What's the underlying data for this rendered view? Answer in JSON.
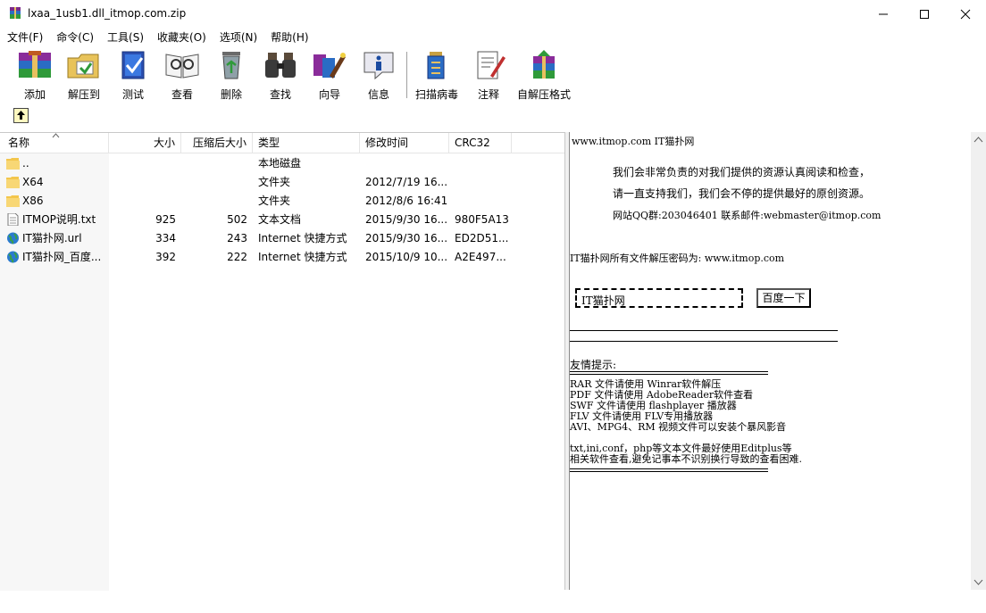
{
  "window": {
    "title": "lxaa_1usb1.dll_itmop.com.zip"
  },
  "menu": [
    "文件(F)",
    "命令(C)",
    "工具(S)",
    "收藏夹(O)",
    "选项(N)",
    "帮助(H)"
  ],
  "toolbar": {
    "add": "添加",
    "extract": "解压到",
    "test": "测试",
    "view": "查看",
    "delete": "删除",
    "find": "查找",
    "wizard": "向导",
    "info": "信息",
    "virus": "扫描病毒",
    "comment": "注释",
    "sfx": "自解压格式"
  },
  "columns": {
    "name": "名称",
    "size": "大小",
    "packed": "压缩后大小",
    "type": "类型",
    "modified": "修改时间",
    "crc": "CRC32"
  },
  "files": [
    {
      "name": "..",
      "size": "",
      "packed": "",
      "type": "本地磁盘",
      "modified": "",
      "crc": "",
      "icon": "folder-icon"
    },
    {
      "name": "X64",
      "size": "",
      "packed": "",
      "type": "文件夹",
      "modified": "2012/7/19 16...",
      "crc": "",
      "icon": "folder-icon"
    },
    {
      "name": "X86",
      "size": "",
      "packed": "",
      "type": "文件夹",
      "modified": "2012/8/6 16:41",
      "crc": "",
      "icon": "folder-icon"
    },
    {
      "name": "ITMOP说明.txt",
      "size": "925",
      "packed": "502",
      "type": "文本文档",
      "modified": "2015/9/30 16...",
      "crc": "980F5A13",
      "icon": "text-file-icon"
    },
    {
      "name": "IT猫扑网.url",
      "size": "334",
      "packed": "243",
      "type": "Internet 快捷方式",
      "modified": "2015/9/30 16...",
      "crc": "ED2D51...",
      "icon": "globe-icon"
    },
    {
      "name": "IT猫扑网_百度...",
      "size": "392",
      "packed": "222",
      "type": "Internet 快捷方式",
      "modified": "2015/10/9 10...",
      "crc": "A2E497...",
      "icon": "globe-icon"
    }
  ],
  "preview": {
    "header": "www.itmop.com  IT猫扑网",
    "line1": "我们会非常负责的对我们提供的资源认真阅读和检查，",
    "line2": "请一直支持我们，我们会不停的提供最好的原创资源。",
    "line3": "网站QQ群:203046401  联系邮件:webmaster@itmop.com",
    "password": "IT猫扑网所有文件解压密码为: www.itmop.com",
    "search_value": "IT猫扑网",
    "search_button": "百度一下",
    "tips_title": "友情提示:",
    "tips": [
      "RAR 文件请使用 Winrar软件解压",
      "PDF 文件请使用 AdobeReader软件查看",
      "SWF 文件请使用 flashplayer 播放器",
      "FLV 文件请使用 FLV专用播放器",
      "AVI、MPG4、RM 视频文件可以安装个暴风影音"
    ],
    "note1": "txt,ini,conf，php等文本文件最好使用Editplus等",
    "note2": "相关软件查看,避免记事本不识别换行导致的查看困难."
  }
}
